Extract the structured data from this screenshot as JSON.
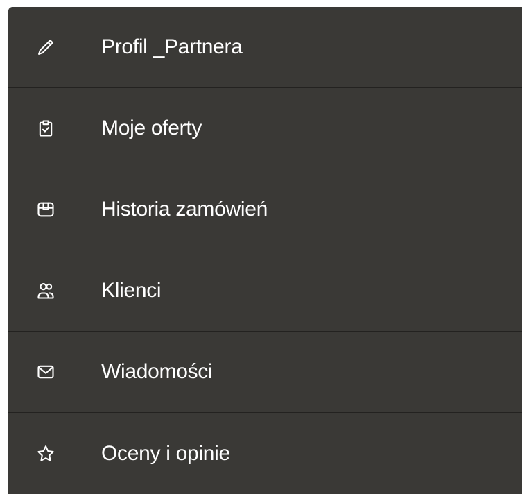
{
  "menu": {
    "items": [
      {
        "label": "Profil _Partnera",
        "icon": "pencil-icon"
      },
      {
        "label": "Moje oferty",
        "icon": "clipboard-check-icon"
      },
      {
        "label": "Historia zamówień",
        "icon": "package-icon"
      },
      {
        "label": "Klienci",
        "icon": "users-icon"
      },
      {
        "label": "Wiadomości",
        "icon": "mail-icon"
      },
      {
        "label": "Oceny i opinie",
        "icon": "star-icon"
      }
    ]
  },
  "colors": {
    "menu_background": "#3a3936",
    "divider": "#232220",
    "text": "#ffffff"
  }
}
